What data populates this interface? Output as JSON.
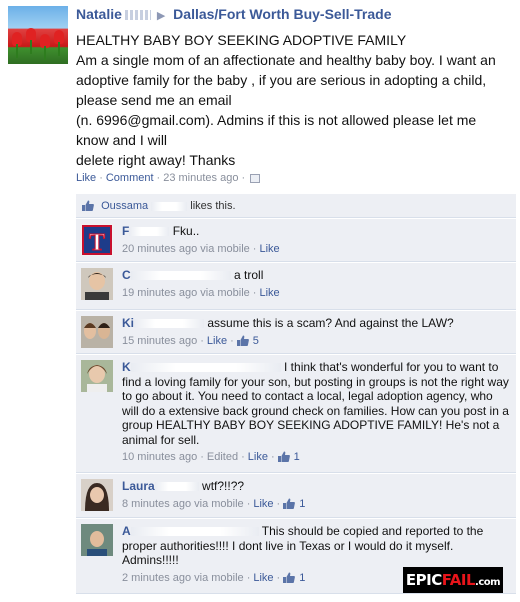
{
  "post": {
    "author": "Natalie",
    "group": "Dallas/Fort Worth Buy-Sell-Trade",
    "lines": [
      "HEALTHY BABY BOY SEEKING ADOPTIVE FAMILY",
      "Am a single mom of an affectionate and healthy baby boy. I want an",
      "adoptive family for the baby , if you are serious in adopting a child,",
      "please send me an email",
      "(n.   6996@gmail.com). Admins if this is not allowed please let me",
      "know and I will",
      "delete right away! Thanks"
    ],
    "like_label": "Like",
    "comment_label": "Comment",
    "time": "23 minutes ago",
    "liked_by_name": "Oussama",
    "liked_by_suffix": "likes this."
  },
  "comments": [
    {
      "name": "F",
      "text": "Fku..",
      "time": "20 minutes ago via mobile",
      "like_label": "Like",
      "edited": "",
      "like_count": ""
    },
    {
      "name": "C",
      "text": "a troll",
      "time": "19 minutes ago via mobile",
      "like_label": "Like",
      "edited": "",
      "like_count": ""
    },
    {
      "name": "Ki",
      "text": "assume this is a scam? And against the LAW?",
      "time": "15 minutes ago",
      "like_label": "Like",
      "edited": "",
      "like_count": "5"
    },
    {
      "name": "K",
      "text": "I think that's wonderful for you to want to find a loving family for your son, but posting in groups is not the right way to go about it. You need to contact a local, legal adoption agency, who will do a extensive back ground check on families. How can you post in a group HEALTHY BABY BOY SEEKING ADOPTIVE FAMILY! He's not a animal for sell.",
      "time": "10 minutes ago",
      "like_label": "Like",
      "edited": "Edited",
      "like_count": "1"
    },
    {
      "name": "Laura",
      "text": "wtf?!!??",
      "time": "8 minutes ago via mobile",
      "like_label": "Like",
      "edited": "",
      "like_count": "1"
    },
    {
      "name": "A",
      "text": "This should be copied and reported to the proper authorities!!!! I dont live in Texas or I would do it myself. Admins!!!!!",
      "time": "2 minutes ago via mobile",
      "like_label": "Like",
      "edited": "",
      "like_count": "1"
    }
  ],
  "watermark": {
    "epic": "EPIC",
    "fail": "FAIL",
    "com": ".com"
  },
  "colors": {
    "link": "#3b5998",
    "comment_bg": "#edeff4",
    "meta": "#898f9c"
  }
}
